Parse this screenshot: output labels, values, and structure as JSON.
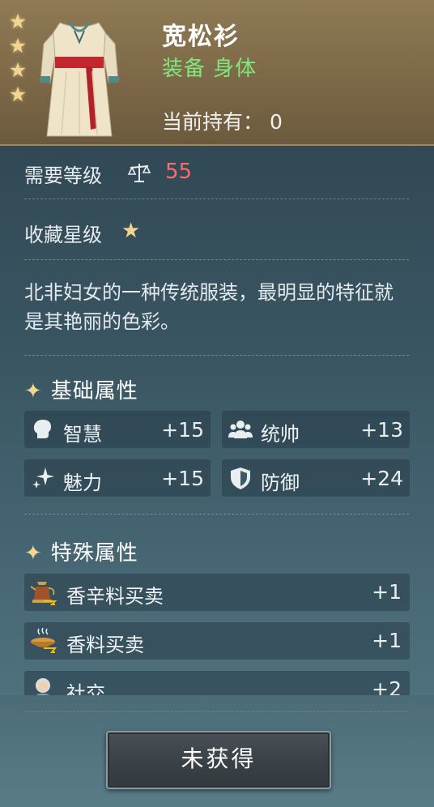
{
  "item": {
    "name": "宽松衫",
    "type": "装备  身体",
    "owned_label": "当前持有：",
    "owned_count": "0",
    "rarity_stars": 4
  },
  "requirement": {
    "label": "需要等级",
    "icon": "balance-scale-icon",
    "value": "55",
    "value_color": "#ff6a6a"
  },
  "collection": {
    "label": "收藏星级",
    "stars": 1
  },
  "description": "北非妇女的一种传统服装，最明显的特征就是其艳丽的色彩。",
  "base_attributes": {
    "title": "基础属性",
    "items": [
      {
        "icon": "head-silhouette-icon",
        "label": "智慧",
        "value": "+15"
      },
      {
        "icon": "group-people-icon",
        "label": "统帅",
        "value": "+13"
      },
      {
        "icon": "sparkles-icon",
        "label": "魅力",
        "value": "+15"
      },
      {
        "icon": "shield-icon",
        "label": "防御",
        "value": "+24"
      }
    ]
  },
  "special_attributes": {
    "title": "特殊属性",
    "items": [
      {
        "icon": "coffee-pot-icon",
        "label": "香辛料买卖",
        "value": "+1"
      },
      {
        "icon": "spice-bowl-icon",
        "label": "香料买卖",
        "value": "+1"
      },
      {
        "icon": "person-portrait-icon",
        "label": "社交",
        "value": "+2"
      }
    ]
  },
  "action": {
    "button_label": "未获得"
  },
  "colors": {
    "header_bg": "#7b6746",
    "star": "#f3d58f",
    "type_text": "#7fe87d",
    "panel_bg": "#3a5663"
  }
}
